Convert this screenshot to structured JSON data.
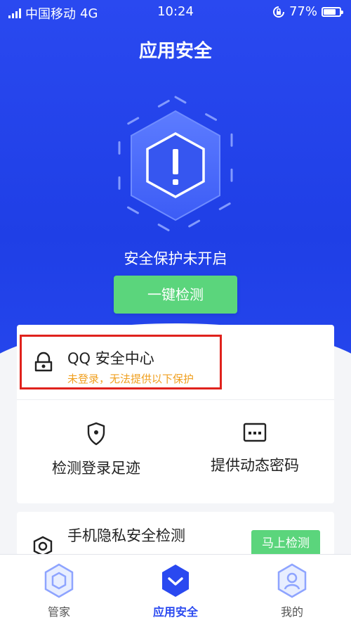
{
  "status_bar": {
    "carrier": "中国移动",
    "network": "4G",
    "time": "10:24",
    "battery": "77%",
    "battery_level": 0.77
  },
  "header": {
    "title": "应用安全"
  },
  "hero": {
    "status_text": "安全保护未开启",
    "scan_button": "一键检测"
  },
  "qq_center": {
    "title": "QQ 安全中心",
    "subtitle": "未登录，无法提供以下保护"
  },
  "features": [
    {
      "label": "检测登录足迹",
      "icon": "location-shield-icon"
    },
    {
      "label": "提供动态密码",
      "icon": "password-dots-icon"
    }
  ],
  "privacy": {
    "title": "手机隐私安全检测",
    "button": "马上检测"
  },
  "tabs": [
    {
      "label": "管家"
    },
    {
      "label": "应用安全"
    },
    {
      "label": "我的"
    }
  ],
  "colors": {
    "primary": "#2a49f0",
    "green": "#5bd57c",
    "warning": "#f0a020",
    "highlight": "#e0221c"
  }
}
